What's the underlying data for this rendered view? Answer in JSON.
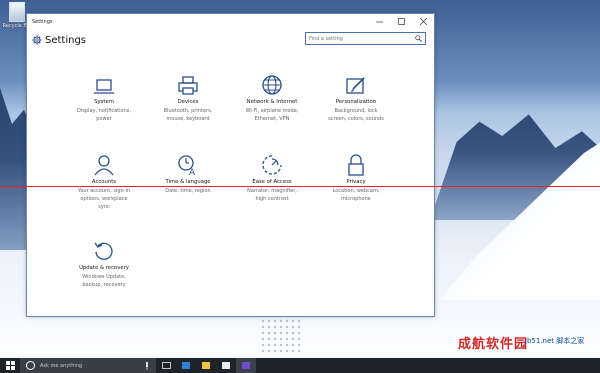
{
  "desktop": {
    "recycle_bin_label": "Recycle Bin"
  },
  "window": {
    "title": "Settings",
    "header_title": "Settings",
    "search_placeholder": "Find a setting",
    "controls": [
      "minimize-icon",
      "maximize-icon",
      "close-icon"
    ]
  },
  "categories": [
    {
      "name": "System",
      "desc": [
        "Display, notifications,",
        "power"
      ],
      "icon": "laptop-icon"
    },
    {
      "name": "Devices",
      "desc": [
        "Bluetooth, printers,",
        "mouse, keyboard"
      ],
      "icon": "printer-icon"
    },
    {
      "name": "Network & Internet",
      "desc": [
        "Wi-Fi, airplane mode,",
        "Ethernet, VPN"
      ],
      "icon": "globe-icon"
    },
    {
      "name": "Personalization",
      "desc": [
        "Background, lock",
        "screen, colors, sounds"
      ],
      "icon": "paint-icon"
    },
    {
      "name": "Accounts",
      "desc": [
        "Your account, sign-in",
        "options, workplace",
        "sync"
      ],
      "icon": "person-icon"
    },
    {
      "name": "Time & language",
      "desc": [
        "Date, time, region",
        ""
      ],
      "icon": "time-language-icon"
    },
    {
      "name": "Ease of Access",
      "desc": [
        "Narrator, magnifier,",
        "high contrast"
      ],
      "icon": "ease-of-access-icon"
    },
    {
      "name": "Privacy",
      "desc": [
        "Location, webcam,",
        "microphone"
      ],
      "icon": "lock-icon"
    },
    {
      "name": "Update & recovery",
      "desc": [
        "Windows Update,",
        "backup, recovery"
      ],
      "icon": "update-icon"
    }
  ],
  "taskbar": {
    "search_placeholder": "Ask me anything"
  },
  "watermark": {
    "main": "成航软件园",
    "sub": "脚本之家",
    "url": "jb51.net"
  },
  "colors": {
    "accent": "#2f6fcb",
    "red_line": "#e3242b"
  }
}
